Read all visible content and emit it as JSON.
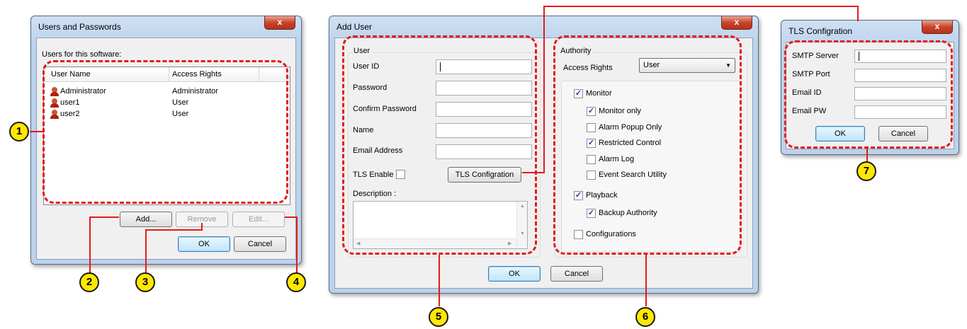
{
  "users_dialog": {
    "title": "Users and Passwords",
    "close_glyph": "x",
    "users_caption": "Users for this software:",
    "columns": [
      "User Name",
      "Access Rights"
    ],
    "rows": [
      {
        "name": "Administrator",
        "rights": "Administrator",
        "icon": "user-icon"
      },
      {
        "name": "user1",
        "rights": "User",
        "icon": "user-icon"
      },
      {
        "name": "user2",
        "rights": "User",
        "icon": "user-icon"
      }
    ],
    "add_label": "Add...",
    "remove_label": "Remove",
    "edit_label": "Edit...",
    "ok_label": "OK",
    "cancel_label": "Cancel"
  },
  "add_user_dialog": {
    "title": "Add User",
    "close_glyph": "x",
    "user_group_label": "User",
    "user_id_label": "User ID",
    "password_label": "Password",
    "confirm_password_label": "Confirm Password",
    "name_label": "Name",
    "email_label": "Email Address",
    "tls_enable_label": "TLS Enable",
    "tls_config_button": "TLS Configration",
    "description_label": "Description :",
    "authority_group_label": "Authority",
    "access_rights_label": "Access Rights",
    "access_rights_value": "User",
    "checkboxes": [
      {
        "label": "Monitor",
        "checked": true
      },
      {
        "label": "Monitor only",
        "checked": true
      },
      {
        "label": "Alarm Popup Only",
        "checked": false
      },
      {
        "label": "Restricted Control",
        "checked": true
      },
      {
        "label": "Alarm Log",
        "checked": false
      },
      {
        "label": "Event Search Utility",
        "checked": false
      },
      {
        "label": "Playback",
        "checked": true
      },
      {
        "label": "Backup Authority",
        "checked": true
      },
      {
        "label": "Configurations",
        "checked": false
      }
    ],
    "ok_label": "OK",
    "cancel_label": "Cancel"
  },
  "tls_dialog": {
    "title": "TLS Configration",
    "close_glyph": "x",
    "smtp_server_label": "SMTP Server",
    "smtp_port_label": "SMTP Port",
    "email_id_label": "Email ID",
    "email_pw_label": "Email PW",
    "ok_label": "OK",
    "cancel_label": "Cancel"
  },
  "badges": [
    "1",
    "2",
    "3",
    "4",
    "5",
    "6",
    "7"
  ],
  "colors": {
    "annotation_red": "#e51a1a",
    "badge_yellow": "#ffe800",
    "window_frame": "#bcd2ec",
    "client_bg": "#f0f0f0"
  }
}
